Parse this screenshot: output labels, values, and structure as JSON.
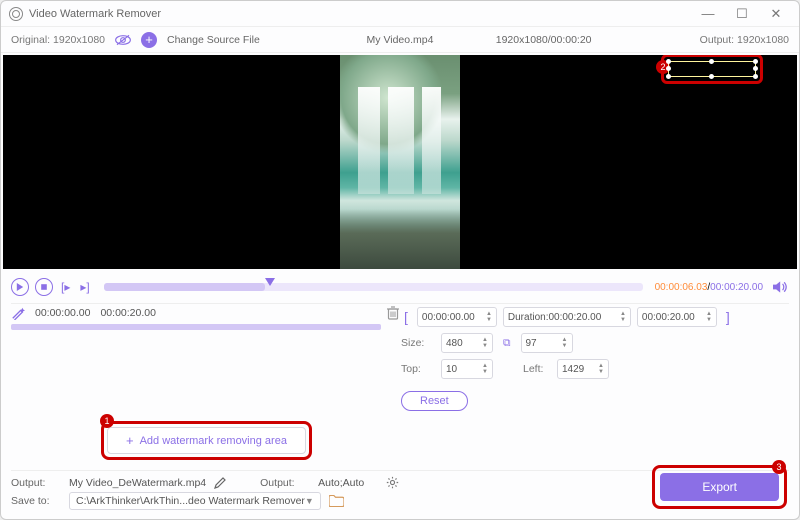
{
  "window": {
    "title": "Video Watermark Remover"
  },
  "toolbar": {
    "original_label": "Original:",
    "original_res": "1920x1080",
    "change_source": "Change Source File",
    "filename": "My Video.mp4",
    "dimensions_time": "1920x1080/00:00:20",
    "output_label": "Output:",
    "output_res": "1920x1080"
  },
  "playback": {
    "current": "00:00:06.03",
    "sep": "/",
    "total": "00:00:20.00"
  },
  "segment": {
    "start": "00:00:00.00",
    "end": "00:00:20.00"
  },
  "add_area_label": "Add watermark removing area",
  "region": {
    "range_start": "00:00:00.00",
    "duration_label": "Duration:",
    "duration": "00:00:20.00",
    "range_end": "00:00:20.00",
    "size_label": "Size:",
    "width": "480",
    "height": "97",
    "top_label": "Top:",
    "top": "10",
    "left_label": "Left:",
    "left": "1429",
    "reset": "Reset"
  },
  "output_row": {
    "label": "Output:",
    "filename": "My Video_DeWatermark.mp4",
    "label2": "Output:",
    "preset": "Auto;Auto"
  },
  "save_row": {
    "label": "Save to:",
    "path": "C:\\ArkThinker\\ArkThin...deo Watermark Remover"
  },
  "export_label": "Export",
  "annotations": {
    "n1": "1",
    "n2": "2",
    "n3": "3"
  }
}
